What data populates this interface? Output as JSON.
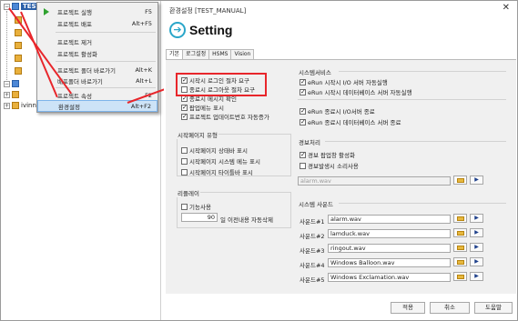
{
  "tree": {
    "root_label": "TEST_MANUAL",
    "second_label": "ivinn"
  },
  "context_menu": {
    "items": [
      {
        "label": "프로젝트 실행",
        "shortcut": "F5"
      },
      {
        "label": "프로젝트 배포",
        "shortcut": "Alt+F5"
      },
      {
        "label": "프로젝트 제거",
        "shortcut": ""
      },
      {
        "label": "프로젝트 활성화",
        "shortcut": ""
      },
      {
        "label": "프로젝트 폴더 바로가기",
        "shortcut": "Alt+K"
      },
      {
        "label": "배포폴더 바로가기",
        "shortcut": "Alt+L"
      },
      {
        "label": "프로젝트 속성",
        "shortcut": "F2"
      },
      {
        "label": "환경설정",
        "shortcut": "Alt+F2"
      }
    ]
  },
  "dialog": {
    "title": "환경설정 [TEST_MANUAL]",
    "close": "✕",
    "header": "Setting",
    "tabs": [
      "기본",
      "로그설정",
      "HSMS",
      "Vision"
    ],
    "left_checks": [
      {
        "label": "시작시 로그인 절차 요구",
        "checked": true
      },
      {
        "label": "종료시 로그아웃 절차 요구",
        "checked": false
      },
      {
        "label": "종료시 메시지 확인",
        "checked": true
      },
      {
        "label": "팝업메뉴 표시",
        "checked": true
      },
      {
        "label": "프로젝트 업데이트번호 자동증가",
        "checked": true
      }
    ],
    "startpage": {
      "title": "시작페이지 유형",
      "items": [
        {
          "label": "시작페이지 상태바 표시",
          "checked": false
        },
        {
          "label": "시작페이지 시스템 메뉴 표시",
          "checked": false
        },
        {
          "label": "시작페이지 타이틀바 표시",
          "checked": false
        }
      ]
    },
    "replay": {
      "title": "리플레이",
      "enable_label": "기능사용",
      "enabled": false,
      "days_value": "90",
      "days_label": "일 이전내용 자동삭제"
    },
    "system_service": {
      "title": "시스템서비스",
      "items": [
        {
          "label": "eRun 시작시 I/O 서버 자동실행",
          "checked": true
        },
        {
          "label": "eRun 시작시 데이터베이스 서버 자동실행",
          "checked": true
        },
        {
          "label": "eRun 종료시 I/O서버 종료",
          "checked": true
        },
        {
          "label": "eRun 종료시 데이터베이스 서버 종료",
          "checked": true
        }
      ]
    },
    "alarm": {
      "title": "경보처리",
      "items": [
        {
          "label": "경보 팝업창 활성화",
          "checked": true
        },
        {
          "label": "경보발생시 소리사용",
          "checked": false
        }
      ],
      "file": "alarm.wav"
    },
    "system_sound": {
      "title": "시스템 사운드",
      "rows": [
        {
          "label": "사운드#1",
          "file": "alarm.wav"
        },
        {
          "label": "사운드#2",
          "file": "lamduck.wav"
        },
        {
          "label": "사운드#3",
          "file": "ringout.wav"
        },
        {
          "label": "사운드#4",
          "file": "Windows Balloon.wav"
        },
        {
          "label": "사운드#5",
          "file": "Windows Exclamation.wav"
        }
      ],
      "play_glyph": "▶"
    },
    "buttons": {
      "apply": "적용",
      "cancel": "취소",
      "help": "도움말"
    },
    "check_glyph": "✓"
  },
  "colors": {
    "accent": "#2aa6c9",
    "highlight_border": "#e8262b"
  }
}
